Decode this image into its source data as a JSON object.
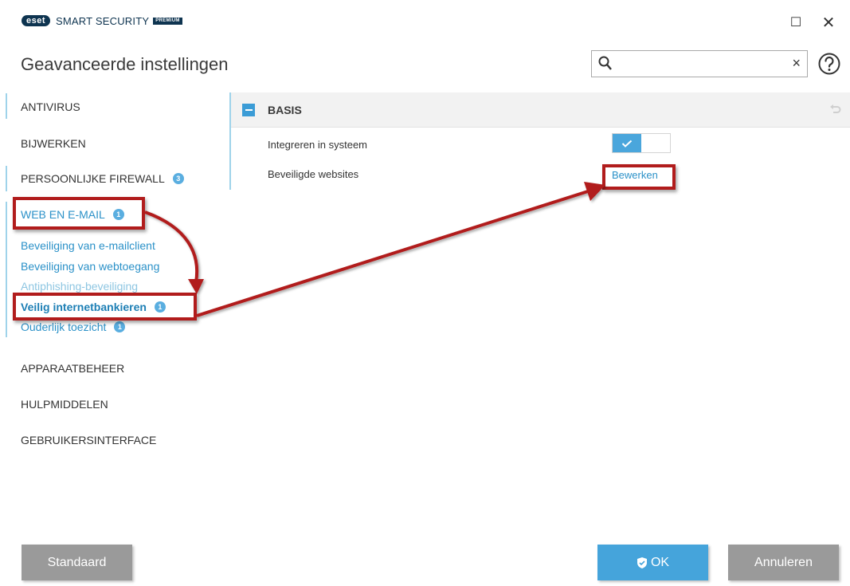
{
  "app": {
    "logo_text": "eset",
    "product_name": "SMART SECURITY",
    "edition": "PREMIUM",
    "maximize_symbol": "☐",
    "close_symbol": "✕"
  },
  "page": {
    "title": "Geavanceerde instellingen"
  },
  "search": {
    "value": "",
    "placeholder": "",
    "clear_symbol": "×"
  },
  "sidebar": {
    "items": [
      {
        "label": "ANTIVIRUS"
      },
      {
        "label": "BIJWERKEN"
      },
      {
        "label": "PERSOONLIJKE FIREWALL",
        "badge": "3"
      },
      {
        "label": "WEB EN E-MAIL",
        "badge": "1"
      },
      {
        "label": "APPARAATBEHEER"
      },
      {
        "label": "HULPMIDDELEN"
      },
      {
        "label": "GEBRUIKERSINTERFACE"
      }
    ],
    "subitems": [
      {
        "label": "Beveiliging van e-mailclient"
      },
      {
        "label": "Beveiliging van webtoegang"
      },
      {
        "label": "Antiphishing-beveiliging"
      },
      {
        "label": "Veilig internetbankieren",
        "badge": "1"
      },
      {
        "label": "Ouderlijk toezicht",
        "badge": "1"
      }
    ]
  },
  "section": {
    "title": "BASIS",
    "settings": [
      {
        "label": "Integreren in systeem",
        "enabled": true
      },
      {
        "label": "Beveiligde websites",
        "action": "Bewerken"
      }
    ]
  },
  "buttons": {
    "default": "Standaard",
    "ok": "OK",
    "cancel": "Annuleren"
  },
  "colors": {
    "accent": "#2b91c8",
    "highlight": "#b11c1c",
    "ok_button": "#45a4db",
    "gray_button": "#9a9a9a"
  }
}
